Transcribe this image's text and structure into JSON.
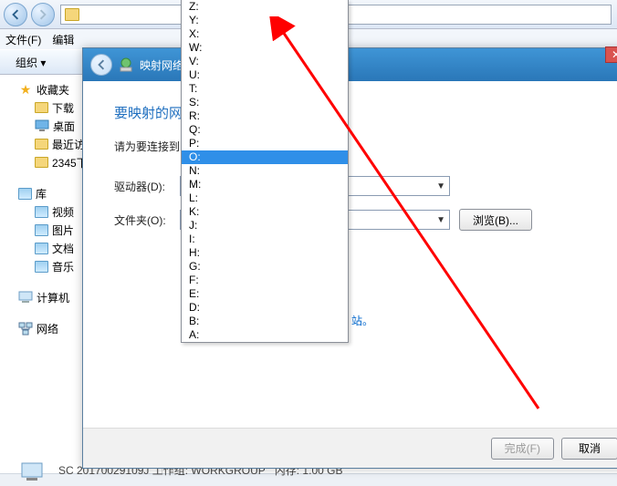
{
  "explorer": {
    "menu": {
      "file": "文件(F)",
      "edit": "编辑"
    },
    "org": "组织 ▾",
    "sidebar": {
      "favorites": "收藏夹",
      "downloads": "下载",
      "desktop": "桌面",
      "recent": "最近访",
      "item2345": "2345下",
      "library": "库",
      "video": "视频",
      "pictures": "图片",
      "documents": "文档",
      "music": "音乐",
      "computer": "计算机",
      "network": "网络"
    },
    "status": {
      "text": "SC 20170029109J 工作组: WORKGROUP",
      "ram": "内存: 1.00 GB"
    }
  },
  "dialog": {
    "title": "映射网络驱",
    "h1": "要映射的网",
    "sub": "请为要连接到",
    "drive_label": "驱动器(D):",
    "folder_label": "文件夹(O):",
    "browse": "浏览(B)...",
    "link": "站。",
    "finish": "完成(F)",
    "cancel": "取消"
  },
  "dropdown": {
    "items": [
      "Z:",
      "Y:",
      "X:",
      "W:",
      "V:",
      "U:",
      "T:",
      "S:",
      "R:",
      "Q:",
      "P:",
      "O:",
      "N:",
      "M:",
      "L:",
      "K:",
      "J:",
      "I:",
      "H:",
      "G:",
      "F:",
      "E:",
      "D:",
      "B:",
      "A:"
    ],
    "selected": "O:"
  }
}
